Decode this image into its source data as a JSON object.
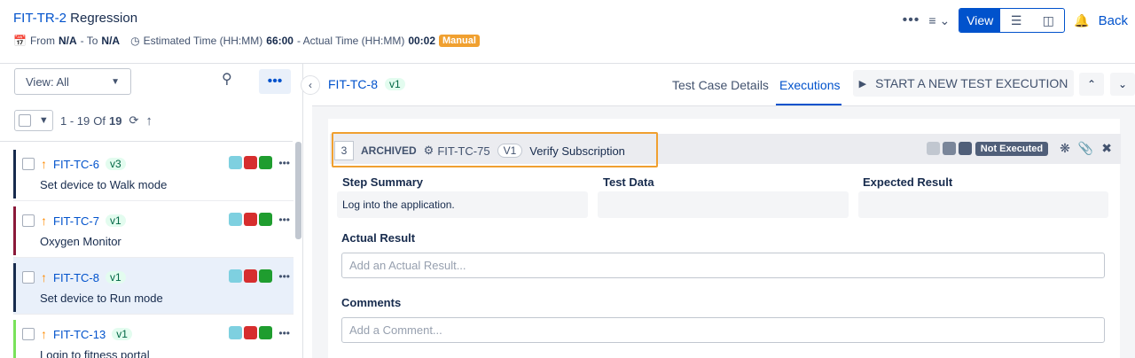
{
  "header": {
    "key": "FIT-TR-2",
    "name": "Regression",
    "from_label": "From",
    "from_value": "N/A",
    "to_label": "- To",
    "to_value": "N/A",
    "estimated_label": "Estimated Time (HH:MM)",
    "estimated_value": "66:00",
    "actual_label": "- Actual Time (HH:MM)",
    "actual_value": "00:02",
    "mode_badge": "Manual",
    "view_label": "View",
    "back_label": "Back"
  },
  "left_panel": {
    "view_select": "View: All",
    "paging_range": "1 - 19",
    "paging_of": "Of",
    "paging_total": "19",
    "items": [
      {
        "key": "FIT-TC-6",
        "version": "v3",
        "name": "Set device to Walk mode",
        "bar_color": "#172b4d"
      },
      {
        "key": "FIT-TC-7",
        "version": "v1",
        "name": "Oxygen Monitor",
        "bar_color": "#8b1a3a"
      },
      {
        "key": "FIT-TC-8",
        "version": "v1",
        "name": "Set device to Run mode",
        "bar_color": "#172b4d"
      },
      {
        "key": "FIT-TC-13",
        "version": "v1",
        "name": "Login to fitness portal",
        "bar_color": "#79e25a"
      }
    ],
    "status_colors": [
      "#7ed0e0",
      "#d62e2e",
      "#1f9d2f"
    ]
  },
  "right_panel": {
    "tc_key": "FIT-TC-8",
    "tc_version": "v1",
    "tab_details": "Test Case Details",
    "tab_executions": "Executions",
    "start_button": "START A NEW TEST EXECUTION",
    "step": {
      "number": "3",
      "status": "ARCHIVED",
      "linked_key": "FIT-TC-75",
      "linked_version": "V1",
      "title": "Verify Subscription",
      "execution_status": "Not Executed"
    },
    "columns": {
      "step_summary": "Step Summary",
      "test_data": "Test Data",
      "expected_result": "Expected Result"
    },
    "step_summary_value": "Log into the application.",
    "actual_result_label": "Actual Result",
    "actual_result_placeholder": "Add an Actual Result...",
    "comments_label": "Comments",
    "comments_placeholder": "Add a Comment..."
  }
}
